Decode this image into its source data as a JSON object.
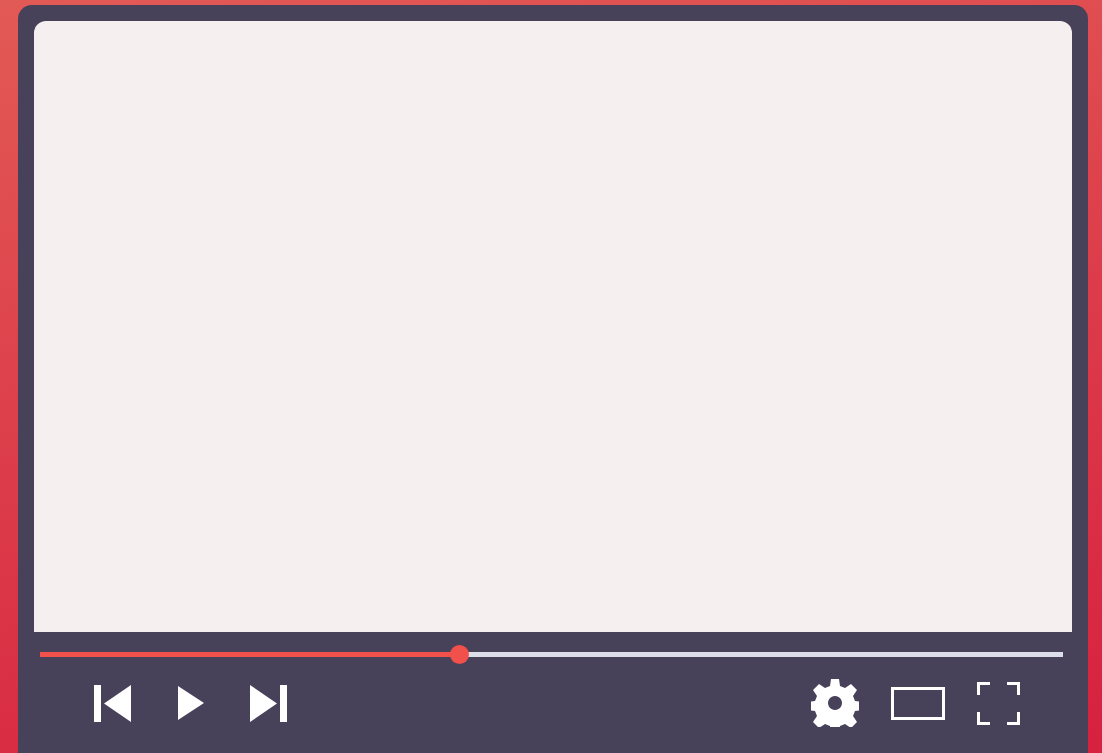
{
  "player": {
    "progress": {
      "level": 0.41
    }
  }
}
